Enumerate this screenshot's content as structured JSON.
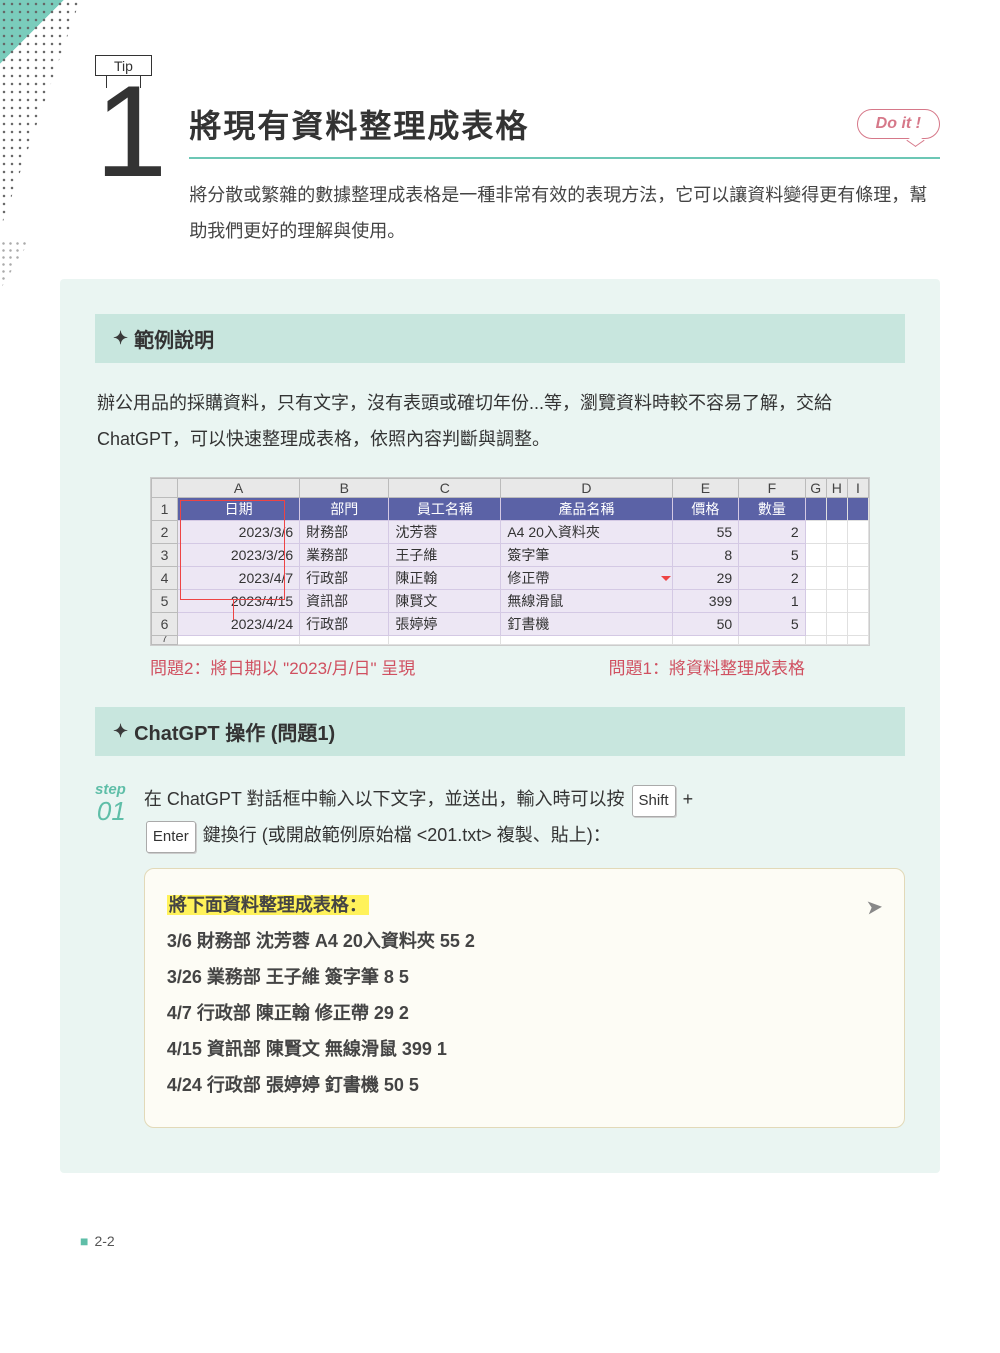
{
  "tip_label": "Tip",
  "tip_number": "1",
  "title": "將現有資料整理成表格",
  "doit_label": "Do it !",
  "intro": "將分散或繁雜的數據整理成表格是一種非常有效的表現方法，它可以讓資料變得更有條理，幫助我們更好的理解與使用。",
  "section1_title": "範例說明",
  "section1_body": "辦公用品的採購資料，只有文字，沒有表頭或確切年份...等，瀏覽資料時較不容易了解，交給 ChatGPT，可以快速整理成表格，依照內容判斷與調整。",
  "excel": {
    "cols": [
      "A",
      "B",
      "C",
      "D",
      "E",
      "F",
      "G",
      "H",
      "I"
    ],
    "header": [
      "日期",
      "部門",
      "員工名稱",
      "產品名稱",
      "價格",
      "數量"
    ],
    "rows": [
      {
        "n": "2",
        "cells": [
          "2023/3/6",
          "財務部",
          "沈芳蓉",
          "A4 20入資料夾",
          "55",
          "2"
        ]
      },
      {
        "n": "3",
        "cells": [
          "2023/3/26",
          "業務部",
          "王子維",
          "簽字筆",
          "8",
          "5"
        ]
      },
      {
        "n": "4",
        "cells": [
          "2023/4/7",
          "行政部",
          "陳正翰",
          "修正帶",
          "29",
          "2"
        ]
      },
      {
        "n": "5",
        "cells": [
          "2023/4/15",
          "資訊部",
          "陳賢文",
          "無線滑鼠",
          "399",
          "1"
        ]
      },
      {
        "n": "6",
        "cells": [
          "2023/4/24",
          "行政部",
          "張婷婷",
          "釘書機",
          "50",
          "5"
        ]
      }
    ],
    "extra_row": "7"
  },
  "anno1": "問題2：將日期以 \"2023/月/日\" 呈現",
  "anno2": "問題1：將資料整理成表格",
  "section2_title": "ChatGPT 操作 (問題1)",
  "step": {
    "label": "step",
    "num": "01"
  },
  "step_text_1": "在 ChatGPT 對話框中輸入以下文字，並送出，輸入時可以按 ",
  "key_shift": "Shift",
  "plus": " + ",
  "key_enter": "Enter",
  "step_text_2": " 鍵換行 (或開啟範例原始檔 <201.txt> 複製、貼上)：",
  "prompt": {
    "head": "將下面資料整理成表格：",
    "lines": [
      "3/6 財務部 沈芳蓉 A4 20入資料夾 55 2",
      "3/26 業務部 王子維 簽字筆 8 5",
      "4/7 行政部 陳正翰 修正帶 29 2",
      "4/15 資訊部 陳賢文 無線滑鼠 399 1",
      "4/24 行政部 張婷婷 釘書機 50 5"
    ]
  },
  "page_number": "2-2"
}
